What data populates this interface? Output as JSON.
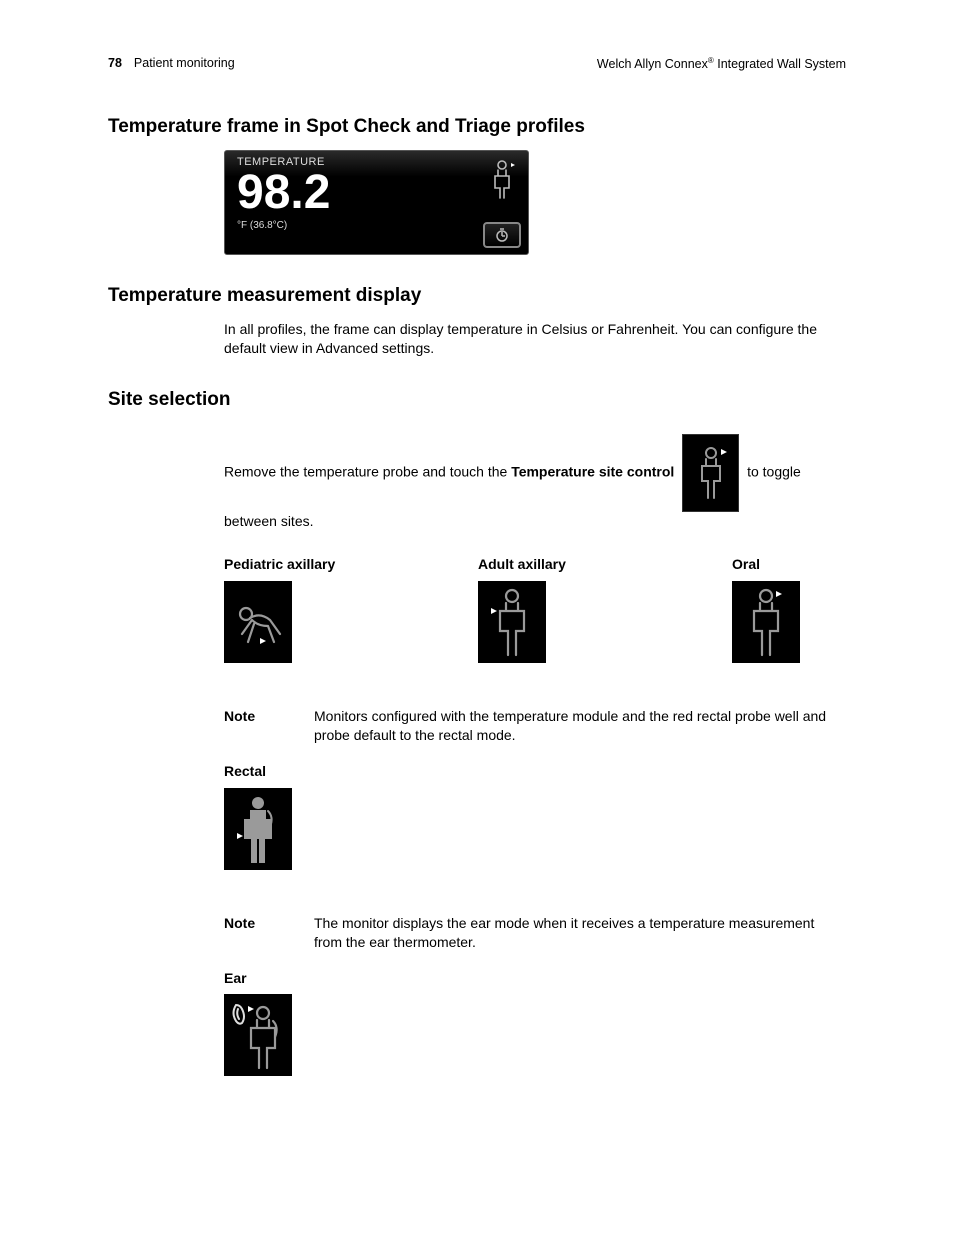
{
  "header": {
    "page_number": "78",
    "section": "Patient monitoring",
    "product_left": "Welch Allyn Connex",
    "product_right": " Integrated Wall System",
    "reg": "®"
  },
  "h_frame": "Temperature frame in Spot Check and Triage profiles",
  "temp_widget": {
    "label": "TEMPERATURE",
    "value": "98.2",
    "unit": "°F (36.8°C)"
  },
  "h_display": "Temperature measurement display",
  "display_text": "In all profiles, the frame can display temperature in Celsius or Fahrenheit. You can configure the default view in Advanced settings.",
  "h_site": "Site selection",
  "site_text_a": "Remove the temperature probe and touch the ",
  "site_text_bold": "Temperature site control",
  "site_text_b": " to toggle between sites.",
  "sites": {
    "ped": "Pediatric axillary",
    "adult": "Adult axillary",
    "oral": "Oral",
    "rectal": "Rectal",
    "ear": "Ear"
  },
  "note_label": "Note",
  "note1": "Monitors configured with the temperature module and the red rectal probe well and probe default to the rectal mode.",
  "note2": "The monitor displays the ear mode when it receives a temperature measurement from the ear thermometer."
}
